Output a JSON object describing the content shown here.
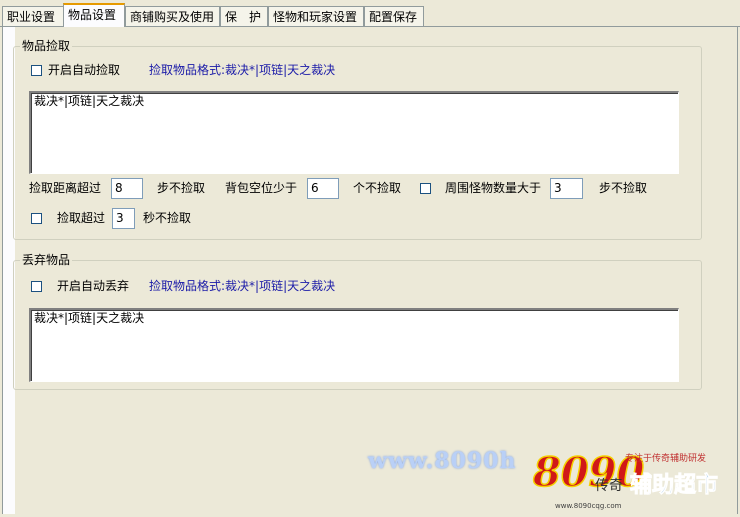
{
  "tabs": [
    {
      "label": "职业设置",
      "active": false
    },
    {
      "label": "物品设置",
      "active": true
    },
    {
      "label": "商铺购买及使用",
      "active": false
    },
    {
      "label": "保　护",
      "active": false
    },
    {
      "label": "怪物和玩家设置",
      "active": false
    },
    {
      "label": "配置保存",
      "active": false
    }
  ],
  "pickup": {
    "legend": "物品捡取",
    "auto_label": "开启自动捡取",
    "auto_checked": false,
    "format_hint": "捡取物品格式:裁决*|项链|天之裁决",
    "items_text": "裁决*|项链|天之裁决",
    "distance_prefix": "捡取距离超过",
    "distance_value": "8",
    "distance_suffix": "步不捡取",
    "bag_prefix": "背包空位少于",
    "bag_value": "6",
    "bag_suffix": "个不捡取",
    "monsters_checked": false,
    "monsters_prefix": "周围怪物数量大于",
    "monsters_value": "3",
    "monsters_suffix": "步不捡取",
    "timeout_checked": false,
    "timeout_prefix": "捡取超过",
    "timeout_value": "3",
    "timeout_suffix": "秒不捡取"
  },
  "discard": {
    "legend": "丢弃物品",
    "auto_label": "开启自动丢弃",
    "auto_checked": false,
    "format_hint": "捡取物品格式:裁决*|项链|天之裁决",
    "items_text": "裁决*|项链|天之裁决"
  },
  "watermark": {
    "url": "www.8090h",
    "logo_number": "8090",
    "logo_script": "传奇",
    "tagline": "专注于传奇辅助研发",
    "brand": "辅助超市",
    "site": "www.8090cqg.com"
  },
  "colors": {
    "hint": "#1b1ba8",
    "tab_active_top": "#e69a00",
    "panel_bg": "#ece9d8"
  }
}
